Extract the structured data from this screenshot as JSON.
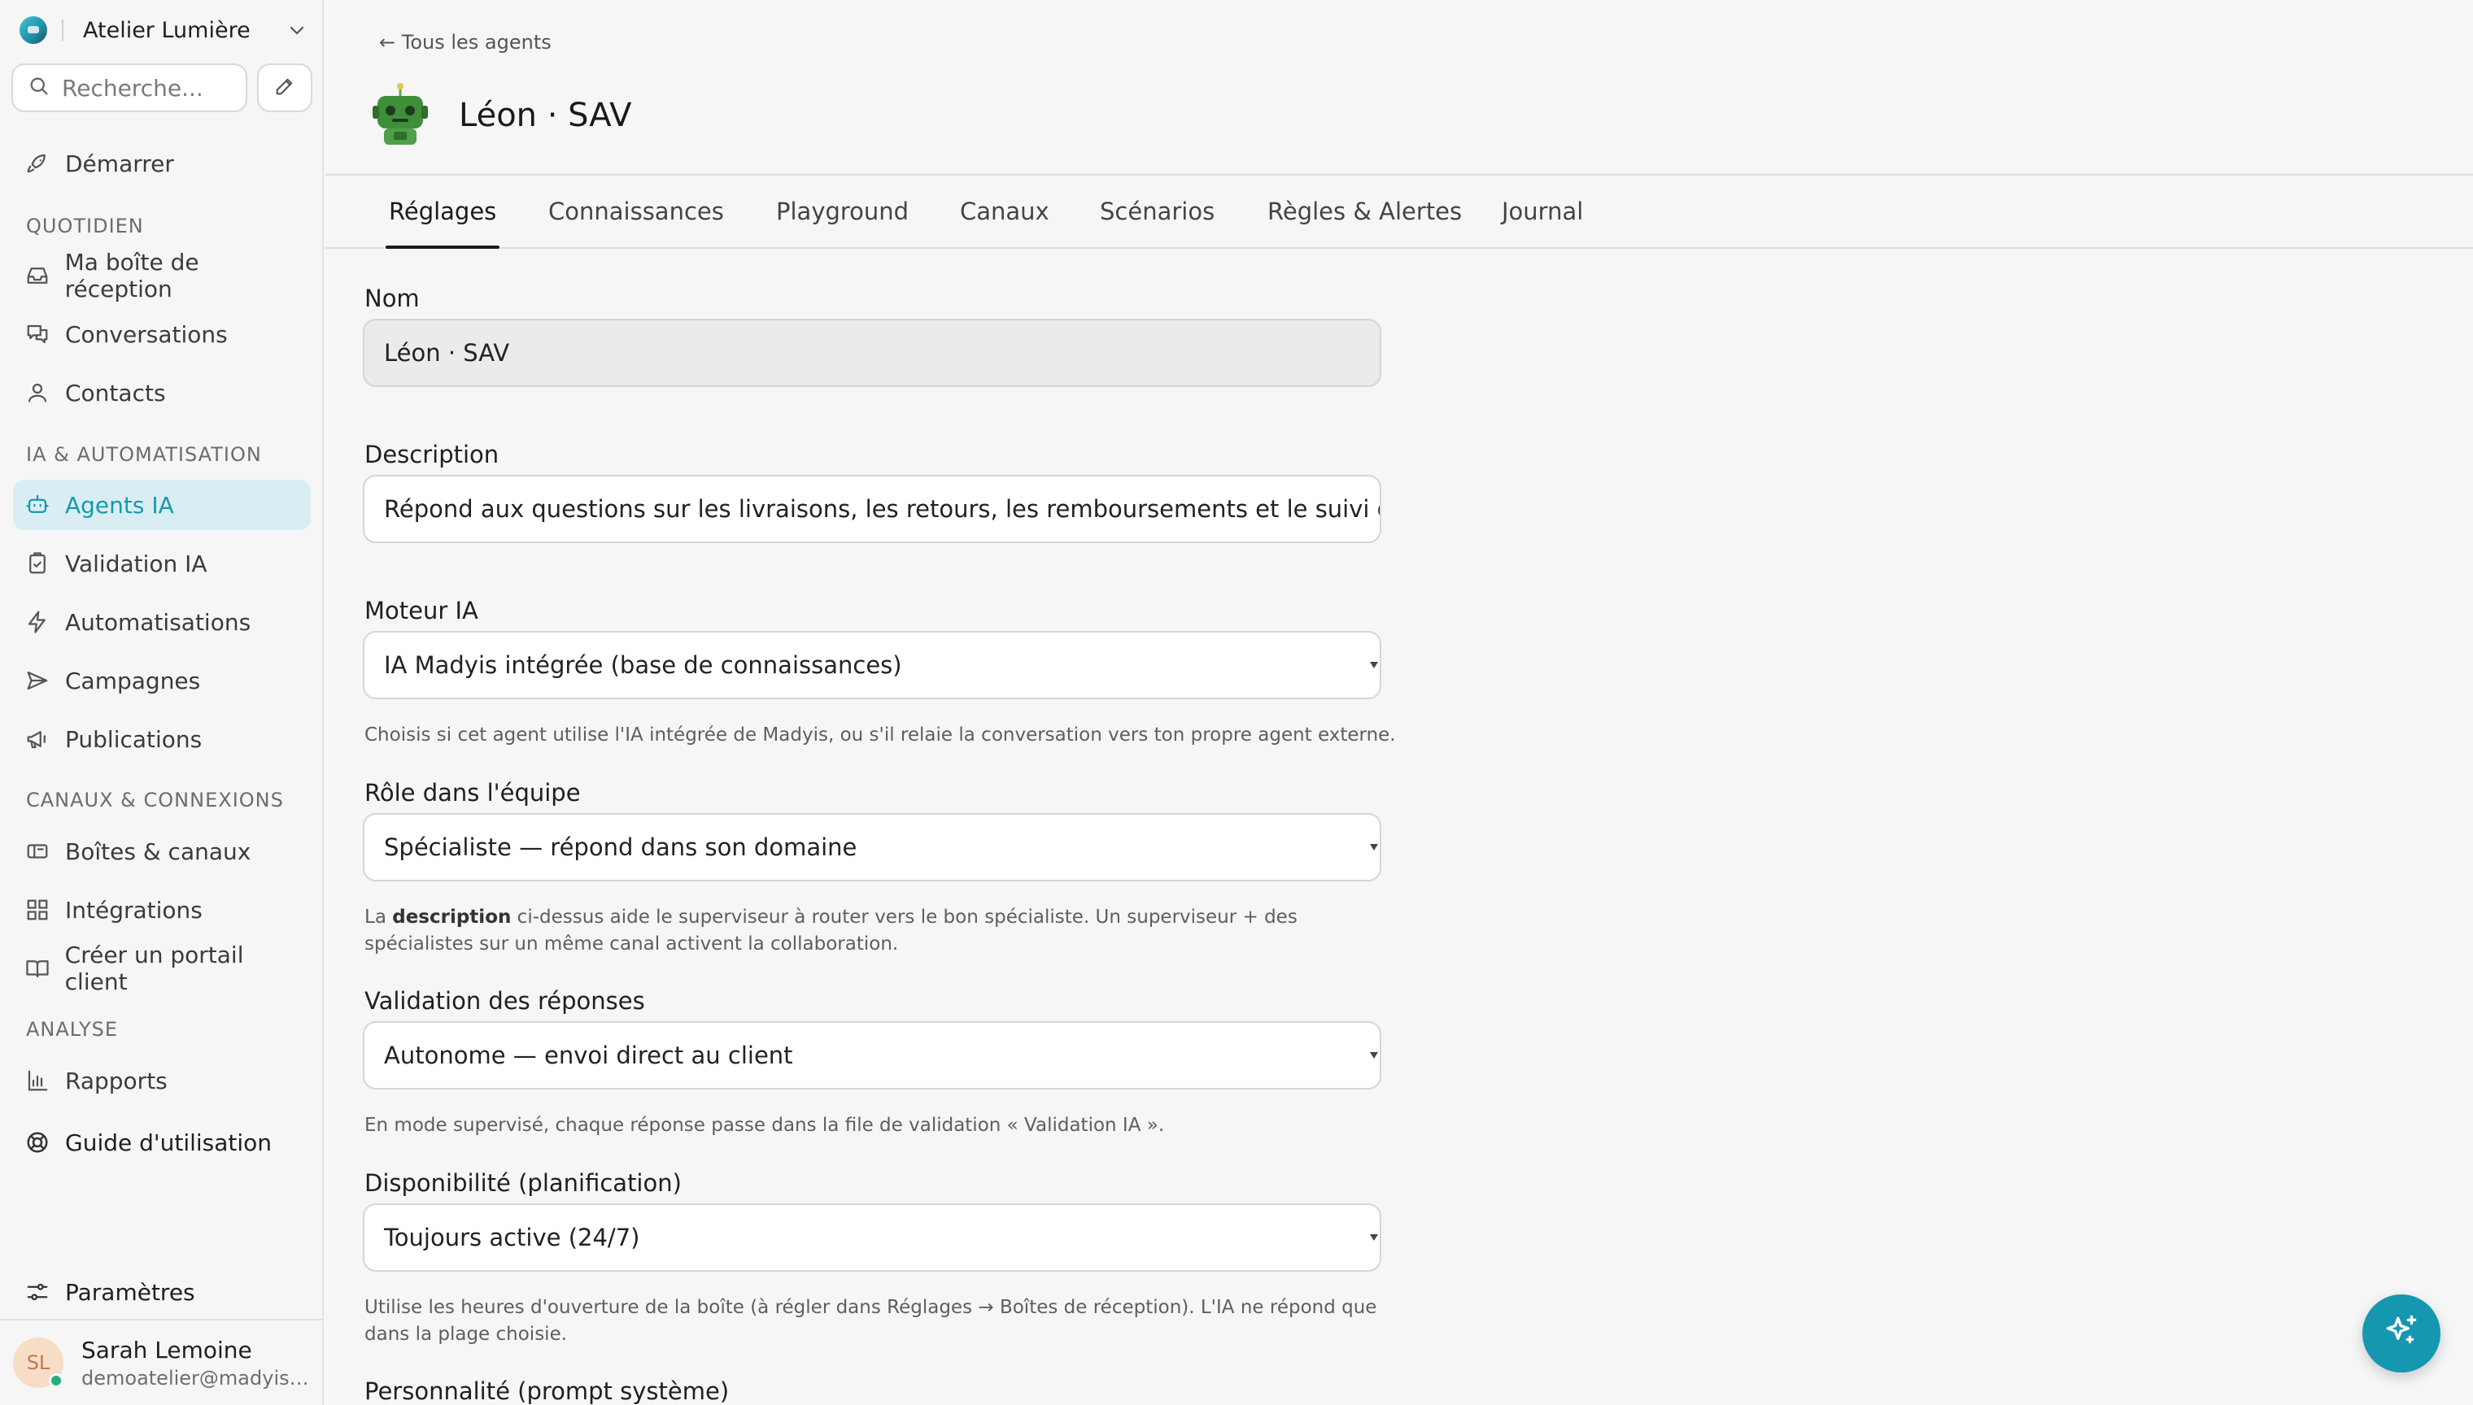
{
  "workspace": {
    "name": "Atelier Lumière"
  },
  "search": {
    "placeholder": "Recherche..."
  },
  "nav": {
    "start": "Démarrer",
    "sections": {
      "daily": "QUOTIDIEN",
      "ai": "IA & AUTOMATISATION",
      "channels": "CANAUX & CONNEXIONS",
      "analysis": "ANALYSE"
    },
    "items": {
      "inbox": "Ma boîte de réception",
      "conversations": "Conversations",
      "contacts": "Contacts",
      "agents": "Agents IA",
      "validation": "Validation IA",
      "automations": "Automatisations",
      "campaigns": "Campagnes",
      "publications": "Publications",
      "boxes": "Boîtes & canaux",
      "integrations": "Intégrations",
      "portal": "Créer un portail client",
      "reports": "Rapports",
      "guide": "Guide d'utilisation",
      "settings": "Paramètres"
    }
  },
  "user": {
    "initials": "SL",
    "name": "Sarah Lemoine",
    "email": "demoatelier@madyish..."
  },
  "header": {
    "back": "← Tous les agents",
    "agent_name": "Léon · SAV"
  },
  "tabs": [
    "Réglages",
    "Connaissances",
    "Playground",
    "Canaux",
    "Scénarios",
    "Règles & Alertes",
    "Journal"
  ],
  "form": {
    "name": {
      "label": "Nom",
      "value": "Léon · SAV"
    },
    "description": {
      "label": "Description",
      "value": "Répond aux questions sur les livraisons, les retours, les remboursements et le suivi de commande."
    },
    "engine": {
      "label": "Moteur IA",
      "value": "IA Madyis intégrée (base de connaissances)",
      "help": "Choisis si cet agent utilise l'IA intégrée de Madyis, ou s'il relaie la conversation vers ton propre agent externe."
    },
    "role": {
      "label": "Rôle dans l'équipe",
      "value": "Spécialiste — répond dans son domaine",
      "help_prefix": "La ",
      "help_bold": "description",
      "help_rest": " ci-dessus aide le superviseur à router vers le bon spécialiste. Un superviseur + des spécialistes sur un même canal activent la collaboration."
    },
    "validation": {
      "label": "Validation des réponses",
      "value": "Autonome — envoi direct au client",
      "help": "En mode supervisé, chaque réponse passe dans la file de validation « Validation IA »."
    },
    "availability": {
      "label": "Disponibilité (planification)",
      "value": "Toujours active (24/7)",
      "help": "Utilise les heures d'ouverture de la boîte (à régler dans Réglages → Boîtes de réception). L'IA ne répond que dans la plage choisie."
    },
    "personality": {
      "label": "Personnalité (prompt système)"
    }
  },
  "colors": {
    "accent": "#1597b0",
    "active_bg": "#d9eef3"
  }
}
